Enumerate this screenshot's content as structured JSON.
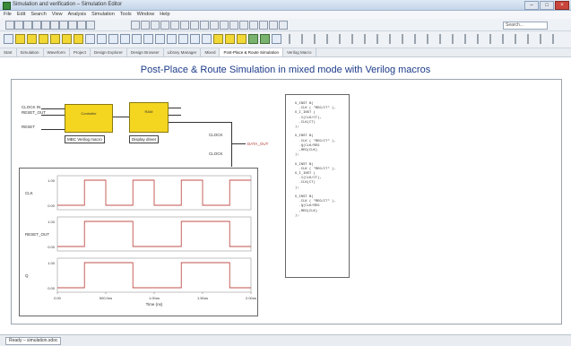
{
  "window": {
    "title": "Simulation and verification – Simulation Editor",
    "controls": [
      "–",
      "□",
      "×"
    ]
  },
  "menu": [
    "File",
    "Edit",
    "Search",
    "View",
    "Analysis",
    "Simulation",
    "Tools",
    "Window",
    "Help"
  ],
  "toolbar": {
    "search_placeholder": "Search..."
  },
  "tabs": [
    "Start",
    "Simulation",
    "Waveform",
    "Project",
    "Design Explorer",
    "Design Browser",
    "Library Manager",
    "Mixed",
    "Post-Place & Route Simulation",
    "Verilog Macro"
  ],
  "page": {
    "title": "Post-Place & Route Simulation in mixed mode with Verilog macros"
  },
  "schematic": {
    "inputs": [
      "CLOCK IN",
      "RESET_OUT",
      "RESET"
    ],
    "block1": {
      "name": "Controller"
    },
    "block2": {
      "name": "RAM"
    },
    "caption1": "MBC Verilog macro",
    "caption2": "Display driver",
    "pins": [
      "CLOCK",
      "CLOCK"
    ],
    "output": "DATA_OUT"
  },
  "code_lines": [
    "U_INST B(",
    "  .CLK ( \"REG/CT\" ),",
    "U_I_INST (",
    "  .I(CLK/CT),",
    "  .CLK(CT)",
    ");",
    "U_INST B(",
    "  .CLK ( \"REG/CT\" ),",
    "  .Q(CLK/REG",
    "  ,REG(CLK)",
    ");",
    "U_INST B(",
    "  .CLK ( \"REG/CT\" ),",
    "U_I_INST (",
    "  .I(CLK/CT),",
    "  .CLK(CT)",
    ");",
    "U_INST B(",
    "  .CLK ( \"REG/CT\" ),",
    "  .Q(CLK/REG",
    "  ,REG(CLK)",
    ");"
  ],
  "chart_data": {
    "type": "line",
    "title": "",
    "xlabel": "Time (ns)",
    "x_ticks": [
      "0.00",
      "500.0ns",
      "1.00us",
      "1.50us",
      "2.00us"
    ],
    "series": [
      {
        "name": "CLK",
        "y_ticks": [
          "1.00",
          "0.00"
        ],
        "color": "#c0504d",
        "edges": [
          0.0,
          0.14,
          0.25,
          0.39,
          0.5,
          0.64,
          0.75,
          0.89,
          1.0
        ],
        "start_high": false
      },
      {
        "name": "RESET_OUT",
        "y_ticks": [
          "1.00",
          "0.00"
        ],
        "color": "#c0504d",
        "edges": [
          0.0,
          0.14,
          0.39,
          0.64,
          0.89,
          1.0
        ],
        "start_high": false
      },
      {
        "name": "Q",
        "y_ticks": [
          "1.00",
          "0.00"
        ],
        "color": "#c0504d",
        "edges": [
          0.0,
          0.14,
          0.39,
          0.64,
          0.89,
          1.0
        ],
        "start_high": false
      }
    ]
  },
  "status": {
    "text": "Ready – simulation.sdoc"
  }
}
